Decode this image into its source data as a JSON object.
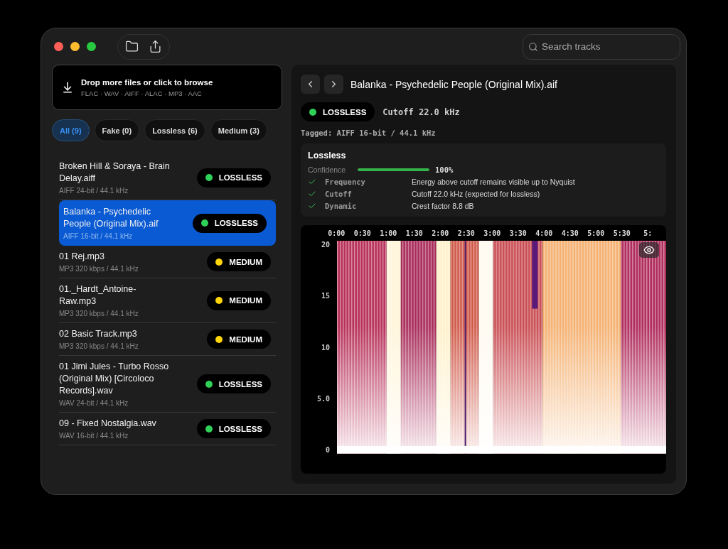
{
  "search": {
    "placeholder": "Search tracks"
  },
  "dropzone": {
    "title": "Drop more files or click to browse",
    "formats": "FLAC · WAV · AIFF · ALAC · MP3 · AAC"
  },
  "filters": [
    {
      "label": "All (9)",
      "selected": true
    },
    {
      "label": "Fake (0)",
      "selected": false
    },
    {
      "label": "Lossless (6)",
      "selected": false
    },
    {
      "label": "Medium (3)",
      "selected": false
    }
  ],
  "tracks": [
    {
      "name": "Broken Hill & Soraya - Brain Delay.aiff",
      "format": "AIFF 24-bit / 44.1 kHz",
      "verdict": "LOSSLESS",
      "color": "#30d158",
      "selected": false
    },
    {
      "name": "Balanka - Psychedelic People (Original Mix).aif",
      "format": "AIFF 16-bit / 44.1 kHz",
      "verdict": "LOSSLESS",
      "color": "#30d158",
      "selected": true
    },
    {
      "name": "01 Rej.mp3",
      "format": "MP3 320 kbps / 44.1 kHz",
      "verdict": "MEDIUM",
      "color": "#ffd60a",
      "selected": false
    },
    {
      "name": "01._Hardt_Antoine-Raw.mp3",
      "format": "MP3 320 kbps / 44.1 kHz",
      "verdict": "MEDIUM",
      "color": "#ffd60a",
      "selected": false
    },
    {
      "name": "02 Basic Track.mp3",
      "format": "MP3 320 kbps / 44.1 kHz",
      "verdict": "MEDIUM",
      "color": "#ffd60a",
      "selected": false
    },
    {
      "name": "01 Jimi Jules - Turbo Rosso (Original Mix) [Circoloco Records].wav",
      "format": "WAV 24-bit / 44.1 kHz",
      "verdict": "LOSSLESS",
      "color": "#30d158",
      "selected": false
    },
    {
      "name": "09 - Fixed Nostalgia.wav",
      "format": "WAV 16-bit / 44.1 kHz",
      "verdict": "LOSSLESS",
      "color": "#30d158",
      "selected": false
    }
  ],
  "detail": {
    "title": "Balanka - Psychedelic People (Original Mix).aif",
    "verdict": "LOSSLESS",
    "color": "#30d158",
    "cutoff": "Cutoff 22.0 kHz",
    "tagged": "Tagged: AIFF 16-bit / 44.1 kHz",
    "card": {
      "title": "Lossless",
      "confidence_label": "Confidence",
      "level": 1,
      "confidence": "100%",
      "checks": [
        {
          "name": "Frequency",
          "text": "Energy above cutoff remains visible up to Nyquist",
          "passed": true
        },
        {
          "name": "Cutoff",
          "text": "Cutoff 22.0 kHz (expected for lossless)",
          "passed": true
        },
        {
          "name": "Dynamic",
          "text": "Crest factor 8.8 dB",
          "passed": true
        }
      ]
    }
  },
  "spectrogram": {
    "x_ticks": [
      "0:00",
      "0:30",
      "1:00",
      "1:30",
      "2:00",
      "2:30",
      "3:00",
      "3:30",
      "4:00",
      "4:30",
      "5:00",
      "5:30",
      "5:"
    ],
    "y_ticks": [
      "20",
      "15",
      "10",
      "5.0",
      "0"
    ]
  }
}
